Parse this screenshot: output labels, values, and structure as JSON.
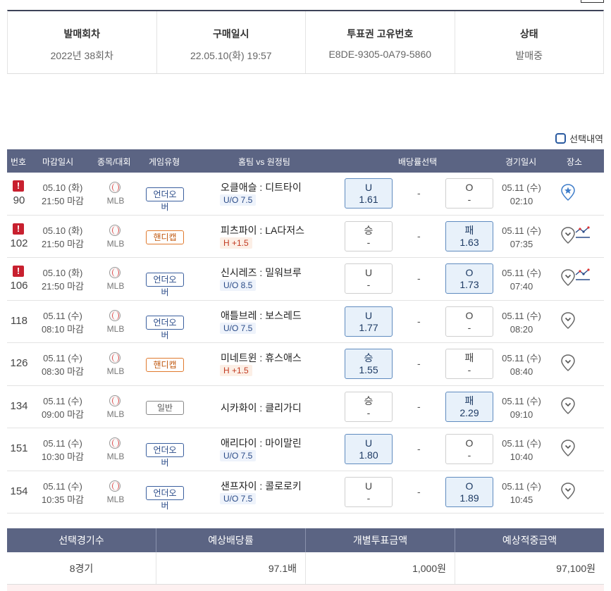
{
  "info": {
    "headers": [
      "발매회차",
      "구매일시",
      "투표권 고유번호",
      "상태"
    ],
    "values": [
      "2022년 38회차",
      "22.05.10(화) 19:57",
      "E8DE-9305-0A79-5860",
      "발매중"
    ]
  },
  "select_history_label": "선택내역",
  "table_headers": {
    "no": "번호",
    "deadline": "마감일시",
    "sport": "종목/대회",
    "type": "게임유형",
    "teams": "홈팀 vs 원정팀",
    "odds": "배당률선택",
    "gametime": "경기일시",
    "venue": "장소"
  },
  "warning_icon": "!",
  "rows": [
    {
      "no": "90",
      "warn": true,
      "deadline_date": "05.10 (화)",
      "deadline_time": "21:50 마감",
      "league": "MLB",
      "type": "언더오버",
      "type_kind": "uo",
      "teams": "오클애슬 : 디트타이",
      "tag": "U/O 7.5",
      "tag_kind": "uo",
      "left_label": "U",
      "left_odd": "1.61",
      "left_sel": true,
      "mid": "-",
      "right_label": "O",
      "right_odd": "-",
      "right_sel": false,
      "game_date": "05.11 (수)",
      "game_time": "02:10",
      "icons": [
        "pin-star-icon"
      ]
    },
    {
      "no": "102",
      "warn": true,
      "deadline_date": "05.10 (화)",
      "deadline_time": "21:50 마감",
      "league": "MLB",
      "type": "핸디캡",
      "type_kind": "hc",
      "teams": "피츠파이 : LA다저스",
      "tag": "H +1.5",
      "tag_kind": "h",
      "left_label": "승",
      "left_odd": "-",
      "left_sel": false,
      "mid": "-",
      "right_label": "패",
      "right_odd": "1.63",
      "right_sel": true,
      "game_date": "05.11 (수)",
      "game_time": "07:35",
      "icons": [
        "pin-icon",
        "trend-icon"
      ]
    },
    {
      "no": "106",
      "warn": true,
      "deadline_date": "05.10 (화)",
      "deadline_time": "21:50 마감",
      "league": "MLB",
      "type": "언더오버",
      "type_kind": "uo",
      "teams": "신시레즈 : 밀워브루",
      "tag": "U/O 8.5",
      "tag_kind": "uo",
      "left_label": "U",
      "left_odd": "-",
      "left_sel": false,
      "mid": "-",
      "right_label": "O",
      "right_odd": "1.73",
      "right_sel": true,
      "game_date": "05.11 (수)",
      "game_time": "07:40",
      "icons": [
        "pin-icon",
        "trend-icon"
      ]
    },
    {
      "no": "118",
      "warn": false,
      "deadline_date": "05.11 (수)",
      "deadline_time": "08:10 마감",
      "league": "MLB",
      "type": "언더오버",
      "type_kind": "uo",
      "teams": "애틀브레 : 보스레드",
      "tag": "U/O 7.5",
      "tag_kind": "uo",
      "left_label": "U",
      "left_odd": "1.77",
      "left_sel": true,
      "mid": "-",
      "right_label": "O",
      "right_odd": "-",
      "right_sel": false,
      "game_date": "05.11 (수)",
      "game_time": "08:20",
      "icons": [
        "pin-icon"
      ]
    },
    {
      "no": "126",
      "warn": false,
      "deadline_date": "05.11 (수)",
      "deadline_time": "08:30 마감",
      "league": "MLB",
      "type": "핸디캡",
      "type_kind": "hc",
      "teams": "미네트윈 : 휴스애스",
      "tag": "H +1.5",
      "tag_kind": "h",
      "left_label": "승",
      "left_odd": "1.55",
      "left_sel": true,
      "mid": "-",
      "right_label": "패",
      "right_odd": "-",
      "right_sel": false,
      "game_date": "05.11 (수)",
      "game_time": "08:40",
      "icons": [
        "pin-icon"
      ]
    },
    {
      "no": "134",
      "warn": false,
      "deadline_date": "05.11 (수)",
      "deadline_time": "09:00 마감",
      "league": "MLB",
      "type": "일반",
      "type_kind": "normal",
      "teams": "시카화이 : 클리가디",
      "tag": "",
      "tag_kind": "",
      "left_label": "승",
      "left_odd": "-",
      "left_sel": false,
      "mid": "-",
      "right_label": "패",
      "right_odd": "2.29",
      "right_sel": true,
      "game_date": "05.11 (수)",
      "game_time": "09:10",
      "icons": [
        "pin-icon"
      ]
    },
    {
      "no": "151",
      "warn": false,
      "deadline_date": "05.11 (수)",
      "deadline_time": "10:30 마감",
      "league": "MLB",
      "type": "언더오버",
      "type_kind": "uo",
      "teams": "애리다이 : 마이말린",
      "tag": "U/O 7.5",
      "tag_kind": "uo",
      "left_label": "U",
      "left_odd": "1.80",
      "left_sel": true,
      "mid": "-",
      "right_label": "O",
      "right_odd": "-",
      "right_sel": false,
      "game_date": "05.11 (수)",
      "game_time": "10:40",
      "icons": [
        "pin-icon"
      ]
    },
    {
      "no": "154",
      "warn": false,
      "deadline_date": "05.11 (수)",
      "deadline_time": "10:35 마감",
      "league": "MLB",
      "type": "언더오버",
      "type_kind": "uo",
      "teams": "샌프자이 : 콜로로키",
      "tag": "U/O 7.5",
      "tag_kind": "uo",
      "left_label": "U",
      "left_odd": "-",
      "left_sel": false,
      "mid": "-",
      "right_label": "O",
      "right_odd": "1.89",
      "right_sel": true,
      "game_date": "05.11 (수)",
      "game_time": "10:45",
      "icons": [
        "pin-icon"
      ]
    }
  ],
  "summary": {
    "headers": [
      "선택경기수",
      "예상배당률",
      "개별투표금액",
      "예상적중금액"
    ],
    "values": [
      "8경기",
      "97.1배",
      "1,000원",
      "97,100원"
    ]
  }
}
